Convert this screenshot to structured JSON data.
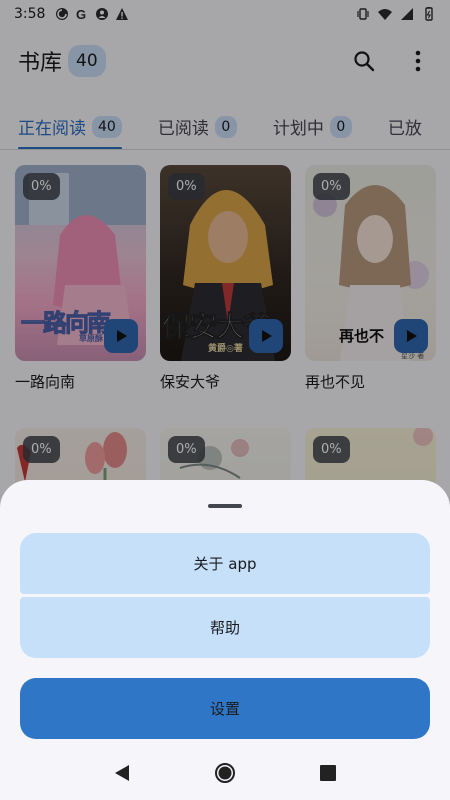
{
  "status_bar": {
    "time": "3:58",
    "left_icons": [
      "pocket-casts-icon",
      "google-icon",
      "account-icon",
      "alert-icon"
    ],
    "right_icons": [
      "vibrate-icon",
      "wifi-icon",
      "signal-icon",
      "battery-icon"
    ]
  },
  "app_bar": {
    "title": "书库",
    "count": "40",
    "icons": [
      "search-icon",
      "more-vert-icon"
    ]
  },
  "tabs": [
    {
      "label": "正在阅读",
      "count": "40",
      "active": true
    },
    {
      "label": "已阅读",
      "count": "0"
    },
    {
      "label": "计划中",
      "count": "0"
    },
    {
      "label": "已放"
    }
  ],
  "books": [
    {
      "title": "一路向南",
      "progress": "0%",
      "cover_text": "一路向南",
      "cover_sub": "草原酥"
    },
    {
      "title": "保安大爷",
      "progress": "0%",
      "cover_text": "保安大爷",
      "cover_sub": "黄爵◎著"
    },
    {
      "title": "再也不见",
      "progress": "0%",
      "cover_text": "再也不",
      "cover_sub": "星沙 著"
    },
    {
      "progress": "0%"
    },
    {
      "progress": "0%"
    },
    {
      "progress": "0%"
    }
  ],
  "sheet": {
    "menu": [
      "关于 app",
      "帮助"
    ],
    "settings_label": "设置"
  },
  "nav_bar": {
    "icons": [
      "back-icon",
      "home-icon",
      "recents-icon"
    ]
  },
  "colors": {
    "accent": "#2c6fc2",
    "badge": "#c8dcf5",
    "menu_item": "#c6e0fa",
    "primary_button": "#3076c6"
  }
}
